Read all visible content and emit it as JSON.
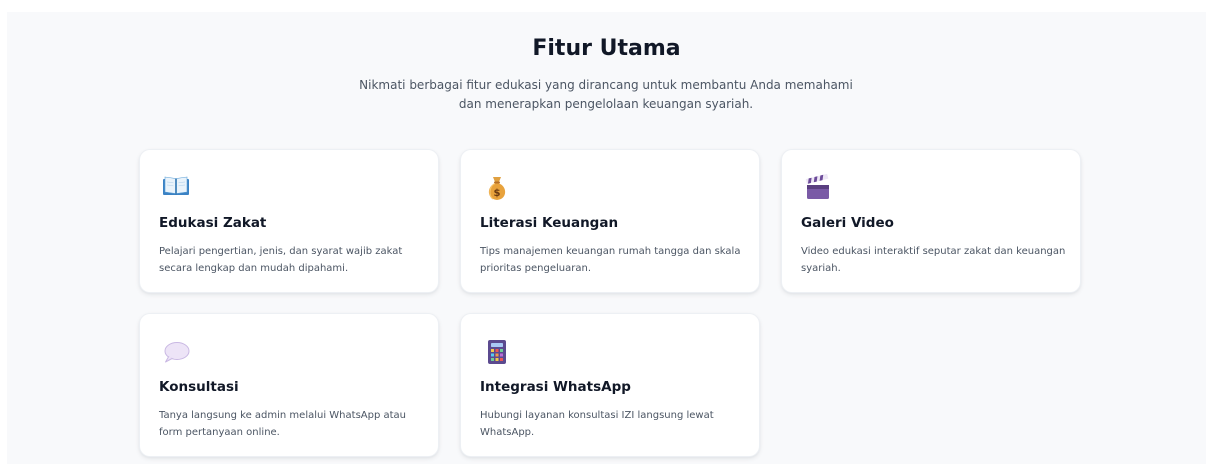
{
  "section": {
    "title": "Fitur Utama",
    "subtitle": "Nikmati berbagai fitur edukasi yang dirancang untuk membantu Anda memahami dan menerapkan pengelolaan keuangan syariah."
  },
  "features": [
    {
      "icon": "open-book-icon",
      "title": "Edukasi Zakat",
      "description": "Pelajari pengertian, jenis, dan syarat wajib zakat secara lengkap dan mudah dipahami."
    },
    {
      "icon": "money-bag-icon",
      "title": "Literasi Keuangan",
      "description": "Tips manajemen keuangan rumah tangga dan skala prioritas pengeluaran."
    },
    {
      "icon": "clapperboard-icon",
      "title": "Galeri Video",
      "description": "Video edukasi interaktif seputar zakat dan keuangan syariah."
    },
    {
      "icon": "speech-bubble-icon",
      "title": "Konsultasi",
      "description": "Tanya langsung ke admin melalui WhatsApp atau form pertanyaan online."
    },
    {
      "icon": "calculator-icon",
      "title": "Integrasi WhatsApp",
      "description": "Hubungi layanan konsultasi IZI langsung lewat WhatsApp."
    }
  ],
  "colors": {
    "background": "#f8f9fb",
    "card": "#ffffff",
    "heading": "#111827",
    "body_text": "#4b5563"
  }
}
